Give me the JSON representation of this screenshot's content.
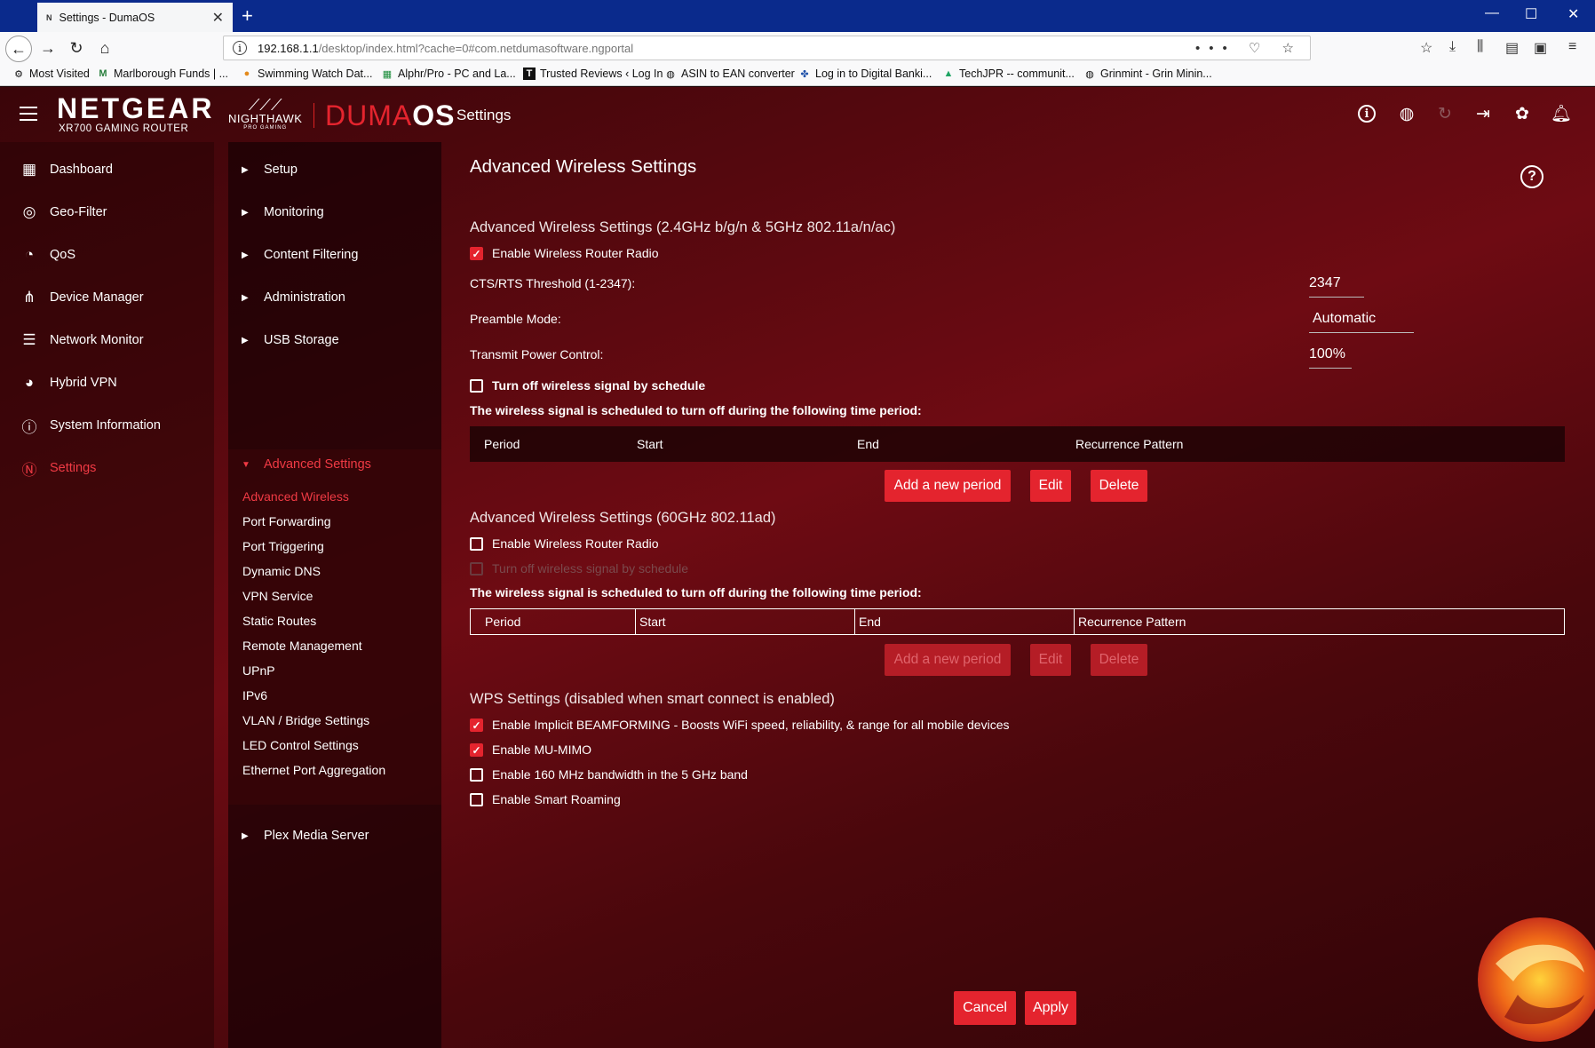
{
  "browser": {
    "tab_title": "Settings - DumaOS",
    "tab_favicon": "N",
    "url_host": "192.168.1.1",
    "url_path": "/desktop/index.html?cache=0#com.netdumasoftware.ngportal",
    "bookmarks": [
      {
        "label": "Most Visited",
        "icon": "gear-icon"
      },
      {
        "label": "Marlborough Funds | ...",
        "icon": "m-icon"
      },
      {
        "label": "Swimming Watch Dat...",
        "icon": "pin-icon"
      },
      {
        "label": "Alphr/Pro - PC and La...",
        "icon": "sheet-icon"
      },
      {
        "label": "Trusted Reviews ‹ Log In",
        "icon": "t-icon"
      },
      {
        "label": "ASIN to EAN converter",
        "icon": "globe-icon"
      },
      {
        "label": "Log in to Digital Banki...",
        "icon": "puzzle-icon"
      },
      {
        "label": "TechJPR -- communit...",
        "icon": "drive-icon"
      },
      {
        "label": "Grinmint - Grin Minin...",
        "icon": "globe-icon"
      }
    ]
  },
  "header": {
    "brand": "NETGEAR",
    "model": "XR700 GAMING ROUTER",
    "nighthawk": "NIGHTHAWK",
    "nighthawk_sub": "PRO GAMING",
    "duma": "DUMA",
    "os": "OS",
    "title": "Settings"
  },
  "leftnav": [
    {
      "label": "Dashboard",
      "icon": "dashboard-icon"
    },
    {
      "label": "Geo-Filter",
      "icon": "geo-filter-icon"
    },
    {
      "label": "QoS",
      "icon": "qos-icon"
    },
    {
      "label": "Device Manager",
      "icon": "device-manager-icon"
    },
    {
      "label": "Network Monitor",
      "icon": "network-monitor-icon"
    },
    {
      "label": "Hybrid VPN",
      "icon": "hybrid-vpn-icon"
    },
    {
      "label": "System Information",
      "icon": "system-information-icon"
    },
    {
      "label": "Settings",
      "icon": "settings-icon"
    }
  ],
  "subnav": {
    "top": [
      "Setup",
      "Monitoring",
      "Content Filtering",
      "Administration",
      "USB Storage"
    ],
    "open": "Advanced Settings",
    "children": [
      "Advanced Wireless",
      "Port Forwarding",
      "Port Triggering",
      "Dynamic DNS",
      "VPN Service",
      "Static Routes",
      "Remote Management",
      "UPnP",
      "IPv6",
      "VLAN / Bridge Settings",
      "LED Control Settings",
      "Ethernet Port Aggregation"
    ],
    "bottom": "Plex Media Server"
  },
  "main": {
    "title": "Advanced Wireless Settings",
    "help": "?",
    "section1": {
      "heading": "Advanced Wireless Settings (2.4GHz b/g/n & 5GHz 802.11a/n/ac)",
      "enable_radio": "Enable Wireless Router Radio",
      "cts_label": "CTS/RTS Threshold (1-2347):",
      "cts_value": "2347",
      "preamble_label": "Preamble Mode:",
      "preamble_value": "Automatic",
      "power_label": "Transmit Power Control:",
      "power_value": "100%",
      "schedule_label": "Turn off wireless signal by schedule",
      "schedule_note": "The wireless signal is scheduled to turn off during the following time period:",
      "columns": [
        "Period",
        "Start",
        "End",
        "Recurrence Pattern"
      ],
      "add": "Add a new period",
      "edit": "Edit",
      "delete": "Delete"
    },
    "section2": {
      "heading": "Advanced Wireless Settings (60GHz 802.11ad)",
      "enable_radio": "Enable Wireless Router Radio",
      "schedule_label": "Turn off wireless signal by schedule",
      "schedule_note": "The wireless signal is scheduled to turn off during the following time period:",
      "columns": [
        "Period",
        "Start",
        "End",
        "Recurrence Pattern"
      ],
      "add": "Add a new period",
      "edit": "Edit",
      "delete": "Delete"
    },
    "wps": {
      "heading": "WPS Settings (disabled when smart connect is enabled)",
      "beamforming": "Enable Implicit BEAMFORMING - Boosts WiFi speed, reliability, & range for all mobile devices",
      "mumimo": "Enable MU-MIMO",
      "bw160": "Enable 160 MHz bandwidth in the 5 GHz band",
      "roaming": "Enable Smart Roaming"
    },
    "cancel": "Cancel",
    "apply": "Apply"
  },
  "colors": {
    "accent": "#e4242e",
    "background": "#5a0810"
  }
}
